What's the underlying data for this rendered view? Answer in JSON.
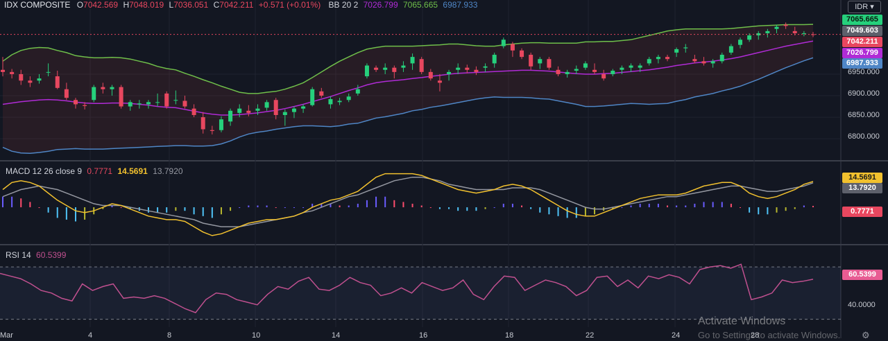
{
  "legend": {
    "symbol": "IDX COMPOSITE",
    "o_key": "O",
    "o_val": "7042.569",
    "h_key": "H",
    "h_val": "7048.019",
    "l_key": "L",
    "l_val": "7036.051",
    "c_key": "C",
    "c_val": "7042.211",
    "change": "+0.571 (+0.01%)",
    "bb_label": "BB 20 2",
    "bb_mid": "7026.799",
    "bb_up": "7065.665",
    "bb_low": "6987.933",
    "macd_label": "MACD 12 26 close 9",
    "macd_hist": "0.7771",
    "macd_line": "14.5691",
    "macd_signal": "13.7920",
    "rsi_label": "RSI 14",
    "rsi_val": "60.5399"
  },
  "currency": "IDR",
  "badges": {
    "bb_up": "7065.665",
    "bb_mid_price": "7049.603",
    "close": "7042.211",
    "bb_mid": "7026.799",
    "bb_low": "6987.933",
    "macd_line": "14.5691",
    "macd_signal": "13.7920",
    "macd_hist": "0.7771",
    "rsi": "60.5399"
  },
  "y_ticks": [
    "6950.000",
    "6900.000",
    "6850.000",
    "6800.000"
  ],
  "macd_ticks": [],
  "rsi_ticks": [
    "40.0000"
  ],
  "x_ticks": [
    "Mar",
    "4",
    "8",
    "10",
    "14",
    "16",
    "18",
    "22",
    "24",
    "28"
  ],
  "watermark": {
    "line1": "Activate Windows",
    "line2": "Go to Settings to activate Windows."
  },
  "colors": {
    "bg": "#131722",
    "up": "#26d07c",
    "down": "#e8475f",
    "bb_upper": "#6fbf4a",
    "bb_basis": "#b02bd6",
    "bb_lower": "#4f86c6",
    "macd": "#f2c12e",
    "signal": "#9598a1",
    "rsi": "#c0508f"
  },
  "chart_data": {
    "type": "line",
    "title": "IDX COMPOSITE",
    "ylim": [
      6760,
      7090
    ],
    "candles": [
      [
        6960,
        6990,
        6945,
        6955
      ],
      [
        6955,
        6962,
        6940,
        6950
      ],
      [
        6950,
        6960,
        6925,
        6935
      ],
      [
        6935,
        6945,
        6920,
        6930
      ],
      [
        6935,
        6950,
        6928,
        6940
      ],
      [
        6955,
        6975,
        6945,
        6955
      ],
      [
        6945,
        6958,
        6915,
        6918
      ],
      [
        6915,
        6930,
        6890,
        6895
      ],
      [
        6890,
        6895,
        6870,
        6880
      ],
      [
        6878,
        6885,
        6868,
        6876
      ],
      [
        6890,
        6925,
        6885,
        6920
      ],
      [
        6920,
        6930,
        6905,
        6915
      ],
      [
        6915,
        6925,
        6900,
        6920
      ],
      [
        6920,
        6925,
        6870,
        6875
      ],
      [
        6875,
        6890,
        6865,
        6885
      ],
      [
        6880,
        6890,
        6870,
        6882
      ],
      [
        6880,
        6890,
        6870,
        6885
      ],
      [
        6885,
        6905,
        6875,
        6885
      ],
      [
        6905,
        6910,
        6870,
        6875
      ],
      [
        6890,
        6912,
        6880,
        6890
      ],
      [
        6888,
        6900,
        6870,
        6875
      ],
      [
        6870,
        6880,
        6850,
        6855
      ],
      [
        6850,
        6862,
        6812,
        6822
      ],
      [
        6820,
        6830,
        6810,
        6818
      ],
      [
        6820,
        6852,
        6815,
        6845
      ],
      [
        6840,
        6870,
        6830,
        6865
      ],
      [
        6860,
        6880,
        6850,
        6870
      ],
      [
        6865,
        6878,
        6852,
        6860
      ],
      [
        6865,
        6880,
        6855,
        6870
      ],
      [
        6872,
        6890,
        6865,
        6885
      ],
      [
        6890,
        6895,
        6845,
        6855
      ],
      [
        6855,
        6868,
        6830,
        6862
      ],
      [
        6862,
        6875,
        6848,
        6870
      ],
      [
        6870,
        6880,
        6860,
        6875
      ],
      [
        6878,
        6920,
        6875,
        6915
      ],
      [
        6910,
        6918,
        6895,
        6900
      ],
      [
        6880,
        6898,
        6870,
        6892
      ],
      [
        6885,
        6895,
        6878,
        6888
      ],
      [
        6890,
        6905,
        6885,
        6898
      ],
      [
        6905,
        6925,
        6900,
        6915
      ],
      [
        6945,
        6975,
        6940,
        6970
      ],
      [
        6965,
        6970,
        6955,
        6960
      ],
      [
        6960,
        6975,
        6950,
        6965
      ],
      [
        6965,
        6970,
        6940,
        6955
      ],
      [
        6965,
        6980,
        6955,
        6970
      ],
      [
        6975,
        6998,
        6960,
        6990
      ],
      [
        6985,
        6990,
        6950,
        6955
      ],
      [
        6955,
        6962,
        6935,
        6940
      ],
      [
        6935,
        6950,
        6910,
        6930
      ],
      [
        6950,
        6960,
        6935,
        6955
      ],
      [
        6960,
        6975,
        6950,
        6965
      ],
      [
        6965,
        6972,
        6952,
        6960
      ],
      [
        6960,
        6968,
        6948,
        6955
      ],
      [
        6965,
        6975,
        6955,
        6968
      ],
      [
        6975,
        7000,
        6965,
        6995
      ],
      [
        7015,
        7035,
        7010,
        7030
      ],
      [
        7020,
        7025,
        6990,
        7005
      ],
      [
        7005,
        7010,
        6985,
        6990
      ],
      [
        6995,
        7000,
        6960,
        6968
      ],
      [
        6975,
        6990,
        6962,
        6985
      ],
      [
        6985,
        6990,
        6960,
        6965
      ],
      [
        6960,
        6968,
        6945,
        6950
      ],
      [
        6950,
        6960,
        6942,
        6955
      ],
      [
        6958,
        6970,
        6950,
        6962
      ],
      [
        6965,
        6980,
        6960,
        6975
      ],
      [
        6960,
        6975,
        6950,
        6955
      ],
      [
        6950,
        6960,
        6935,
        6940
      ],
      [
        6950,
        6962,
        6945,
        6958
      ],
      [
        6960,
        6970,
        6950,
        6965
      ],
      [
        6965,
        6975,
        6955,
        6970
      ],
      [
        6965,
        6975,
        6955,
        6970
      ],
      [
        6975,
        6990,
        6970,
        6985
      ],
      [
        6985,
        6995,
        6975,
        6990
      ],
      [
        6990,
        6995,
        6980,
        6985
      ],
      [
        7000,
        7012,
        6990,
        7008
      ],
      [
        7010,
        7020,
        7000,
        7012
      ],
      [
        6985,
        6995,
        6975,
        6980
      ],
      [
        6980,
        6990,
        6970,
        6975
      ],
      [
        6975,
        6985,
        6965,
        6980
      ],
      [
        6980,
        7000,
        6975,
        6995
      ],
      [
        7000,
        7020,
        6995,
        7015
      ],
      [
        7018,
        7035,
        7010,
        7030
      ],
      [
        7030,
        7045,
        7025,
        7040
      ],
      [
        7040,
        7050,
        7030,
        7045
      ],
      [
        7045,
        7055,
        7035,
        7050
      ],
      [
        7055,
        7065,
        7045,
        7060
      ],
      [
        7065,
        7070,
        7055,
        7062
      ],
      [
        7050,
        7060,
        7040,
        7045
      ],
      [
        7045,
        7050,
        7038,
        7045
      ],
      [
        7042.569,
        7048.019,
        7036.051,
        7042.211
      ]
    ],
    "bb_upper": [
      6980,
      6995,
      7005,
      7010,
      7012,
      7011,
      7005,
      7000,
      6993,
      6990,
      6988,
      6988,
      6989,
      6988,
      6985,
      6980,
      6975,
      6968,
      6963,
      6960,
      6952,
      6945,
      6937,
      6930,
      6922,
      6915,
      6908,
      6905,
      6905,
      6908,
      6910,
      6915,
      6922,
      6930,
      6942,
      6955,
      6968,
      6980,
      6990,
      7000,
      7008,
      7012,
      7015,
      7015,
      7015,
      7015,
      7016,
      7017,
      7018,
      7020,
      7020,
      7018,
      7016,
      7015,
      7015,
      7018,
      7020,
      7022,
      7023,
      7023,
      7022,
      7022,
      7022,
      7022,
      7025,
      7025,
      7026,
      7026,
      7028,
      7030,
      7035,
      7040,
      7045,
      7050,
      7053,
      7055,
      7055,
      7055,
      7055,
      7055,
      7056,
      7058,
      7060,
      7062,
      7063,
      7064,
      7065,
      7065,
      7065,
      7065.665
    ],
    "bb_basis": [
      6880,
      6883,
      6886,
      6888,
      6890,
      6891,
      6890,
      6888,
      6885,
      6883,
      6882,
      6882,
      6883,
      6883,
      6882,
      6880,
      6878,
      6875,
      6873,
      6872,
      6868,
      6864,
      6860,
      6857,
      6855,
      6855,
      6856,
      6858,
      6860,
      6863,
      6866,
      6870,
      6875,
      6880,
      6886,
      6892,
      6898,
      6905,
      6912,
      6918,
      6925,
      6930,
      6933,
      6935,
      6937,
      6940,
      6942,
      6945,
      6947,
      6950,
      6952,
      6953,
      6954,
      6955,
      6956,
      6957,
      6958,
      6959,
      6959,
      6958,
      6957,
      6955,
      6953,
      6951,
      6950,
      6950,
      6951,
      6952,
      6954,
      6956,
      6958,
      6960,
      6963,
      6966,
      6970,
      6973,
      6976,
      6978,
      6980,
      6983,
      6986,
      6990,
      6995,
      7000,
      7005,
      7010,
      7015,
      7019,
      7023,
      7026.799
    ],
    "bb_lower": [
      6780,
      6771,
      6767,
      6766,
      6768,
      6771,
      6775,
      6776,
      6777,
      6776,
      6776,
      6776,
      6777,
      6778,
      6779,
      6780,
      6781,
      6782,
      6783,
      6784,
      6784,
      6783,
      6783,
      6784,
      6788,
      6795,
      6804,
      6811,
      6815,
      6818,
      6822,
      6825,
      6828,
      6830,
      6830,
      6829,
      6828,
      6830,
      6834,
      6836,
      6842,
      6848,
      6851,
      6855,
      6859,
      6865,
      6868,
      6873,
      6876,
      6880,
      6884,
      6888,
      6892,
      6895,
      6897,
      6896,
      6896,
      6896,
      6895,
      6893,
      6892,
      6888,
      6884,
      6880,
      6875,
      6875,
      6876,
      6878,
      6880,
      6882,
      6881,
      6880,
      6881,
      6882,
      6887,
      6891,
      6897,
      6901,
      6905,
      6911,
      6916,
      6922,
      6930,
      6938,
      6947,
      6956,
      6965,
      6973,
      6981,
      6987.933
    ],
    "macd_line": [
      10,
      14,
      15,
      14,
      12,
      8,
      4,
      1,
      -2,
      -3,
      -2,
      0,
      2,
      1,
      -1,
      -3,
      -5,
      -6,
      -7,
      -7,
      -8,
      -11,
      -14,
      -16,
      -15,
      -13,
      -11,
      -9,
      -8,
      -7,
      -7,
      -6,
      -5,
      -3,
      0,
      2,
      4,
      5,
      7,
      9,
      13,
      17,
      19,
      19,
      19,
      19,
      18,
      16,
      14,
      12,
      10,
      9,
      8,
      9,
      10,
      12,
      13,
      12,
      10,
      7,
      4,
      1,
      -2,
      -4,
      -5,
      -5,
      -3,
      -1,
      1,
      3,
      5,
      6,
      7,
      7,
      7,
      8,
      10,
      12,
      13,
      14,
      14,
      12,
      8,
      6,
      5,
      6,
      8,
      10,
      13,
      14.5691
    ],
    "macd_signal": [
      6,
      8,
      10,
      11,
      12,
      11,
      10,
      8,
      6,
      4,
      2,
      1,
      1,
      1,
      0,
      -1,
      -2,
      -3,
      -4,
      -5,
      -6,
      -7,
      -9,
      -10,
      -11,
      -11,
      -11,
      -10,
      -9,
      -8,
      -7,
      -6,
      -5,
      -3,
      -2,
      0,
      2,
      4,
      6,
      7,
      9,
      11,
      13,
      15,
      16,
      17,
      17,
      16,
      15,
      13,
      12,
      11,
      10,
      10,
      10,
      10,
      11,
      11,
      11,
      10,
      8,
      6,
      4,
      2,
      0,
      -1,
      -1,
      0,
      1,
      2,
      3,
      4,
      5,
      6,
      6,
      7,
      8,
      9,
      10,
      11,
      12,
      12,
      11,
      10,
      9,
      9,
      10,
      11,
      12,
      13.792
    ],
    "macd_hist": [
      6,
      6,
      5,
      3,
      0,
      -3,
      -6,
      -7,
      -8,
      -7,
      -4,
      -1,
      1,
      0,
      -1,
      -2,
      -3,
      -3,
      -3,
      -2,
      -2,
      -4,
      -5,
      -6,
      -4,
      -2,
      0,
      1,
      1,
      1,
      0,
      0,
      0,
      0,
      2,
      2,
      2,
      1,
      1,
      2,
      4,
      6,
      6,
      4,
      3,
      2,
      1,
      0,
      -1,
      -1,
      -2,
      -2,
      -2,
      -1,
      0,
      2,
      2,
      1,
      -1,
      -3,
      -4,
      -5,
      -6,
      -6,
      -5,
      -4,
      -2,
      -1,
      0,
      1,
      2,
      2,
      2,
      1,
      1,
      1,
      2,
      3,
      3,
      3,
      2,
      0,
      -3,
      -4,
      -4,
      -3,
      -2,
      -1,
      1,
      0.7771
    ],
    "rsi": [
      65,
      63,
      61,
      57,
      52,
      50,
      46,
      44,
      57,
      52,
      55,
      57,
      46,
      47,
      46,
      48,
      46,
      42,
      38,
      35,
      45,
      50,
      49,
      45,
      43,
      41,
      49,
      55,
      53,
      59,
      62,
      53,
      52,
      56,
      62,
      58,
      56,
      48,
      50,
      54,
      50,
      58,
      55,
      52,
      54,
      60,
      49,
      45,
      55,
      63,
      62,
      52,
      56,
      60,
      58,
      55,
      48,
      52,
      62,
      63,
      55,
      60,
      54,
      63,
      61,
      64,
      62,
      57,
      68,
      70,
      71,
      69,
      72,
      45,
      47,
      50,
      60,
      58,
      59,
      60.5399
    ]
  }
}
